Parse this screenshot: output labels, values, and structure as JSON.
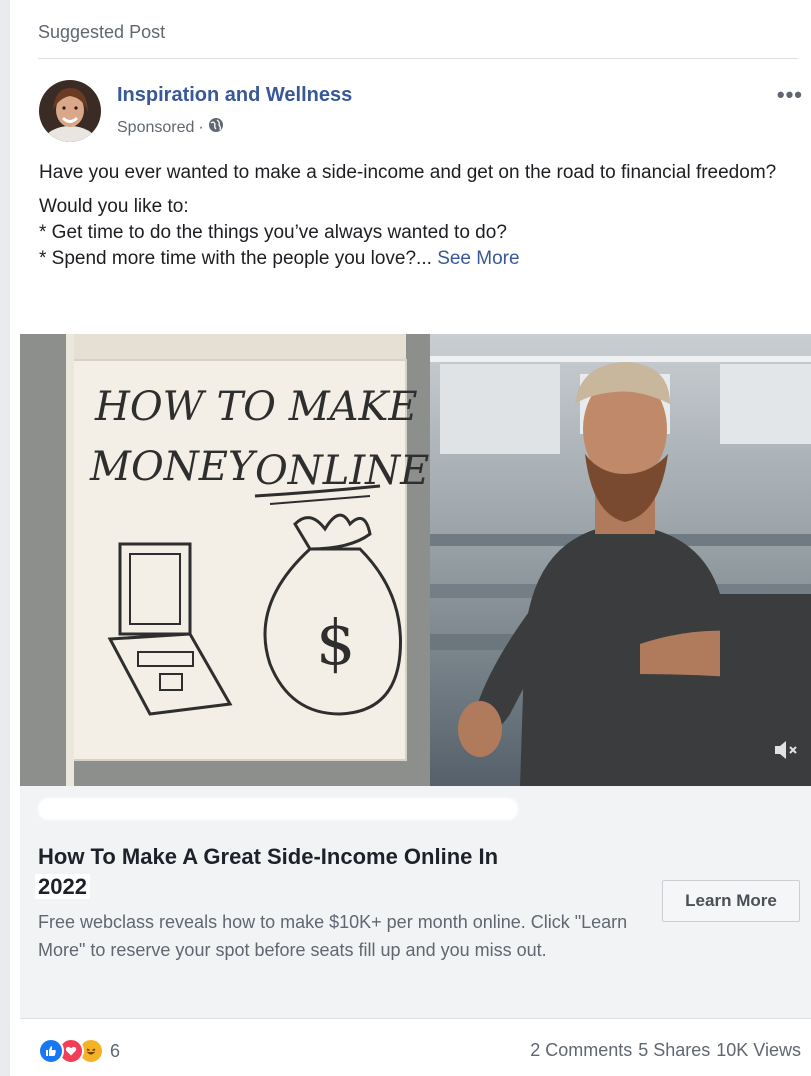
{
  "suggested_label": "Suggested Post",
  "post": {
    "page_name": "Inspiration and Wellness",
    "sponsored_label": "Sponsored",
    "meta_separator": "·",
    "more_icon": "more-options-icon",
    "text_line1": "Have you ever wanted to make a side-income and get on the road to financial freedom?",
    "text_line2": "Would you like to:",
    "text_line3": "* Get time to do the things you’ve always wanted to do?",
    "text_line4": "* Spend more time with the people you love?...",
    "see_more": "See More"
  },
  "video": {
    "board_line1": "HOW TO MAKE",
    "board_line2_a": "MONEY",
    "board_line2_b": "ONLINE",
    "money_symbol": "$",
    "mute_icon": "speaker-muted-icon"
  },
  "link_preview": {
    "title_main": "How To Make A Great Side-Income Online In",
    "title_year": "2022",
    "description": "Free webclass reveals how to make $10K+ per month online. Click \"Learn More\" to reserve your spot before seats fill up and you miss out.",
    "cta_label": "Learn More"
  },
  "engagement": {
    "reaction_icons": [
      "like-icon",
      "love-icon",
      "haha-icon"
    ],
    "reaction_count": "6",
    "comments": "2 Comments",
    "shares": "5 Shares",
    "views": "10K Views"
  },
  "colors": {
    "link_blue": "#385898",
    "like_blue": "#1877f2",
    "love_red": "#f33e58",
    "haha_yellow": "#f7b125"
  }
}
